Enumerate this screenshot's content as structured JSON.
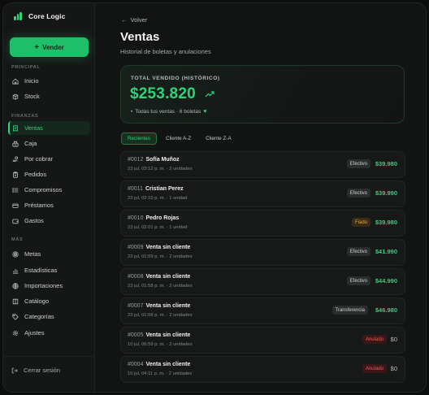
{
  "app": {
    "name": "Core Logic"
  },
  "sidebar": {
    "sell_label": "Vender",
    "sections": {
      "principal": "PRINCIPAL",
      "finanzas": "FINANZAS",
      "mas": "MÁS"
    },
    "items": [
      {
        "label": "Inicio",
        "icon": "home-icon"
      },
      {
        "label": "Stock",
        "icon": "box-icon"
      },
      {
        "label": "Ventas",
        "icon": "receipt-icon",
        "active": true
      },
      {
        "label": "Caja",
        "icon": "cash-register-icon"
      },
      {
        "label": "Por cobrar",
        "icon": "hand-coin-icon"
      },
      {
        "label": "Pedidos",
        "icon": "clipboard-icon"
      },
      {
        "label": "Compromisos",
        "icon": "list-icon"
      },
      {
        "label": "Préstamos",
        "icon": "card-icon"
      },
      {
        "label": "Gastos",
        "icon": "wallet-icon"
      },
      {
        "label": "Metas",
        "icon": "target-icon"
      },
      {
        "label": "Estadísticas",
        "icon": "chart-icon"
      },
      {
        "label": "Importaciones",
        "icon": "globe-icon"
      },
      {
        "label": "Catálogo",
        "icon": "book-icon"
      },
      {
        "label": "Categorías",
        "icon": "tag-icon"
      },
      {
        "label": "Ajustes",
        "icon": "gear-icon"
      }
    ],
    "logout_label": "Cerrar sesión"
  },
  "header": {
    "back_label": "Volver",
    "title": "Ventas",
    "subtitle": "Historial de boletas y anulaciones"
  },
  "summary": {
    "label": "TOTAL VENDIDO (HISTÓRICO)",
    "value": "$253.820",
    "note": "Todas tus ventas · 6 boletas"
  },
  "tabs": [
    "Recientes",
    "Cliente A-Z",
    "Cliente Z-A"
  ],
  "colors": {
    "accent": "#2ed47a",
    "fiado": "#e9a93a",
    "anulado": "#ef5b5b"
  },
  "sales": [
    {
      "num": "#0012",
      "name": "Sofía Muñoz",
      "meta": "23 jul, 03:12 p. m. · 2 unidades",
      "method": "Efectivo",
      "type": "efectivo",
      "amount": "$39.980"
    },
    {
      "num": "#0011",
      "name": "Cristian Perez",
      "meta": "23 jul, 02:10 p. m. · 1 unidad",
      "method": "Efectivo",
      "type": "efectivo",
      "amount": "$39.990"
    },
    {
      "num": "#0010",
      "name": "Pedro Rojas",
      "meta": "23 jul, 02:01 p. m. · 1 unidad",
      "method": "Fiado",
      "type": "fiado",
      "amount": "$39.980"
    },
    {
      "num": "#0009",
      "name": "Venta sin cliente",
      "meta": "23 jul, 01:59 p. m. · 2 unidades",
      "method": "Efectivo",
      "type": "efectivo",
      "amount": "$41.990"
    },
    {
      "num": "#0008",
      "name": "Venta sin cliente",
      "meta": "23 jul, 01:58 p. m. · 2 unidades",
      "method": "Efectivo",
      "type": "efectivo",
      "amount": "$44.990"
    },
    {
      "num": "#0007",
      "name": "Venta sin cliente",
      "meta": "23 jul, 01:58 p. m. · 2 unidades",
      "method": "Transferencia",
      "type": "transfer",
      "amount": "$46.980"
    },
    {
      "num": "#0005",
      "name": "Venta sin cliente",
      "meta": "10 jul, 06:59 p. m. · 2 unidades",
      "method": "Anulado",
      "type": "anulado",
      "amount": "$0"
    },
    {
      "num": "#0004",
      "name": "Venta sin cliente",
      "meta": "10 jul, 04:11 p. m. · 2 unidades",
      "method": "Anulado",
      "type": "anulado",
      "amount": "$0"
    }
  ]
}
